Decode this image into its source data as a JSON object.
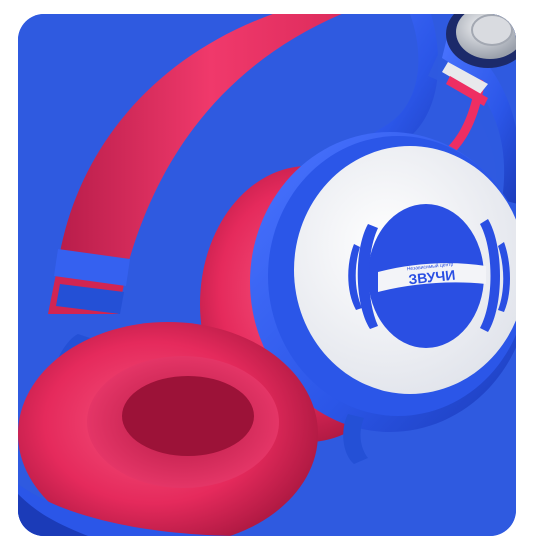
{
  "image": {
    "subject": "headphones-product-photo",
    "colors": {
      "background": "#2f5ae0",
      "headband_red": "#ee2e62",
      "headband_red_shadow": "#b81d4a",
      "frame_blue": "#2b56e8",
      "frame_blue_dark": "#1b3bb8",
      "cup_white": "#f3f4f8",
      "logo_blue": "#2a4fe3",
      "metal": "#c9ccd3"
    },
    "logo": {
      "brand_text": "ЗВУЧИ",
      "tagline_text": "Независимый центр"
    }
  }
}
